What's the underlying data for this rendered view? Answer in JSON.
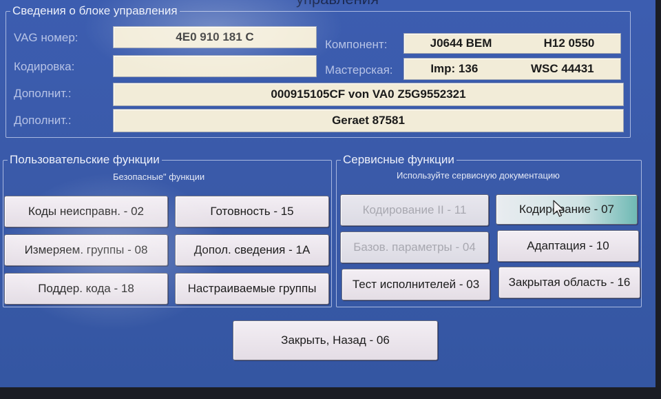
{
  "window": {
    "title": "управления"
  },
  "ecu_info": {
    "group_title": "Сведения о блоке управления",
    "vag_label": "VAG номер:",
    "vag_value": "4E0 910 181 C",
    "component_label": "Компонент:",
    "component_value_1": "J0644 BEM",
    "component_value_2": "H12 0550",
    "coding_label": "Кодировка:",
    "coding_value": "",
    "workshop_label": "Мастерская:",
    "workshop_value_1": "Imp: 136",
    "workshop_value_2": "WSC 44431",
    "extra1_label": "Дополнит.:",
    "extra1_value": "000915105CF von VA0  Z5G9552321",
    "extra2_label": "Дополнит.:",
    "extra2_value": "Geraet 87581"
  },
  "user_functions": {
    "group_title": "Пользовательские функции",
    "hint": "Безопасные\" функции",
    "buttons": [
      "Коды неисправн. - 02",
      "Готовность - 15",
      "Измеряем. группы - 08",
      "Допол. сведения - 1A",
      "Поддер. кода - 18",
      "Настраиваемые группы"
    ]
  },
  "service_functions": {
    "group_title": "Сервисные функции",
    "hint": "Используйте сервисную документацию",
    "buttons": [
      "Кодирование II - 11",
      "Кодирование - 07",
      "Базов. параметры - 04",
      "Адаптация - 10",
      "Тест исполнителей - 03",
      "Закрытая область - 16"
    ]
  },
  "footer": {
    "close_label": "Закрыть, Назад - 06"
  }
}
